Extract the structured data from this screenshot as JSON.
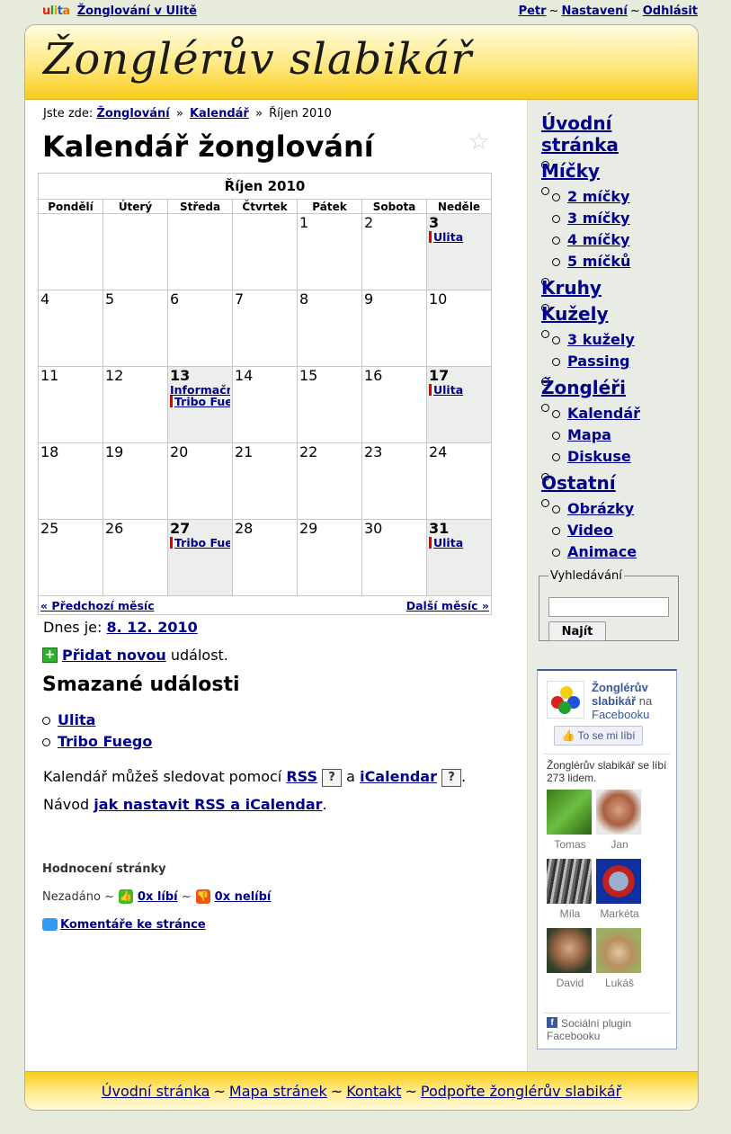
{
  "topbar": {
    "logo": {
      "u": "u",
      "l": "l",
      "i": "i",
      "t": "t",
      "a": "a"
    },
    "site_link": "Žonglování v Ulitě",
    "user": "Petr",
    "settings": "Nastavení",
    "logout": "Odhlásit",
    "sep": "~"
  },
  "header": {
    "title": "Žonglérův slabikář"
  },
  "breadcrumb": {
    "prefix": "Jste zde:",
    "item1": "Žonglování",
    "item2": "Kalendář",
    "current": "Říjen 2010",
    "sep": "»"
  },
  "page_title": "Kalendář žonglování",
  "calendar": {
    "month": "Říjen 2010",
    "days": [
      "Pondělí",
      "Úterý",
      "Středa",
      "Čtvrtek",
      "Pátek",
      "Sobota",
      "Neděle"
    ],
    "weeks": [
      [
        "",
        "",
        "",
        "",
        "1",
        "2",
        "3"
      ],
      [
        "4",
        "5",
        "6",
        "7",
        "8",
        "9",
        "10"
      ],
      [
        "11",
        "12",
        "13",
        "14",
        "15",
        "16",
        "17"
      ],
      [
        "18",
        "19",
        "20",
        "21",
        "22",
        "23",
        "24"
      ],
      [
        "25",
        "26",
        "27",
        "28",
        "29",
        "30",
        "31"
      ]
    ],
    "events": {
      "3": [
        {
          "label": "Ulita",
          "bar": true
        }
      ],
      "13": [
        {
          "label": "Informační...",
          "bar": false
        },
        {
          "label": "Tribo Fuego",
          "bar": true
        }
      ],
      "17": [
        {
          "label": "Ulita",
          "bar": true
        }
      ],
      "27": [
        {
          "label": "Tribo Fuego",
          "bar": true
        }
      ],
      "31": [
        {
          "label": "Ulita",
          "bar": true
        }
      ]
    },
    "prev": "« Předchozí měsíc",
    "next": "Další měsíc »"
  },
  "today": {
    "label": "Dnes je:",
    "date": "8. 12. 2010"
  },
  "add_event": {
    "link": "Přidat novou",
    "suffix": "událost."
  },
  "deleted": {
    "heading": "Smazané události",
    "items": [
      "Ulita",
      "Tribo Fuego"
    ]
  },
  "subscribe": {
    "text1": "Kalendář můžeš sledovat pomocí",
    "rss": "RSS",
    "and": "a",
    "ical": "iCalendar",
    "q": "?",
    "end": ".",
    "guide_prefix": "Návod",
    "guide_link": "jak nastavit RSS a iCalendar",
    "guide_end": "."
  },
  "rating": {
    "title": "Hodnocení stránky",
    "status": "Nezadáno",
    "sep": "~",
    "like": "0x líbí",
    "dislike": "0x nelíbí"
  },
  "comments": "Komentáře ke stránce",
  "nav": {
    "home": "Úvodní stránka",
    "balls": "Míčky",
    "balls_items": [
      "2 míčky",
      "3 míčky",
      "4 míčky",
      "5 míčků"
    ],
    "rings": "Kruhy",
    "clubs": "Kužely",
    "clubs_items": [
      "3 kužely",
      "Passing"
    ],
    "jugglers": "Žongléři",
    "jugglers_items": [
      "Kalendář",
      "Mapa",
      "Diskuse"
    ],
    "other": "Ostatní",
    "other_items": [
      "Obrázky",
      "Video",
      "Animace"
    ]
  },
  "search": {
    "legend": "Vyhledávání",
    "button": "Najít",
    "value": ""
  },
  "facebook": {
    "page_name": "Žonglérův slabikář",
    "on": "na",
    "site": "Facebooku",
    "like_button": "To se mi líbí",
    "count": "Žonglérův slabikář se líbí 273 lidem.",
    "people": [
      "Tomas",
      "Jan",
      "Míla",
      "Markéta",
      "David",
      "Lukáš"
    ],
    "plugin": "Sociální plugin",
    "plugin_site": "Facebooku",
    "fb_letter": "f"
  },
  "footer": {
    "home": "Úvodní stránka",
    "sitemap": "Mapa stránek",
    "contact": "Kontakt",
    "support": "Podpořte žonglérův slabikář",
    "sep": "~"
  },
  "colors": {
    "link": "#00008b",
    "header_yellow": "#f8cc18",
    "event_bar": "#e00000",
    "weekend_cell": "#ebeeea",
    "sidebar_bg": "#e8ece4",
    "facebook_blue": "#3b5998"
  }
}
